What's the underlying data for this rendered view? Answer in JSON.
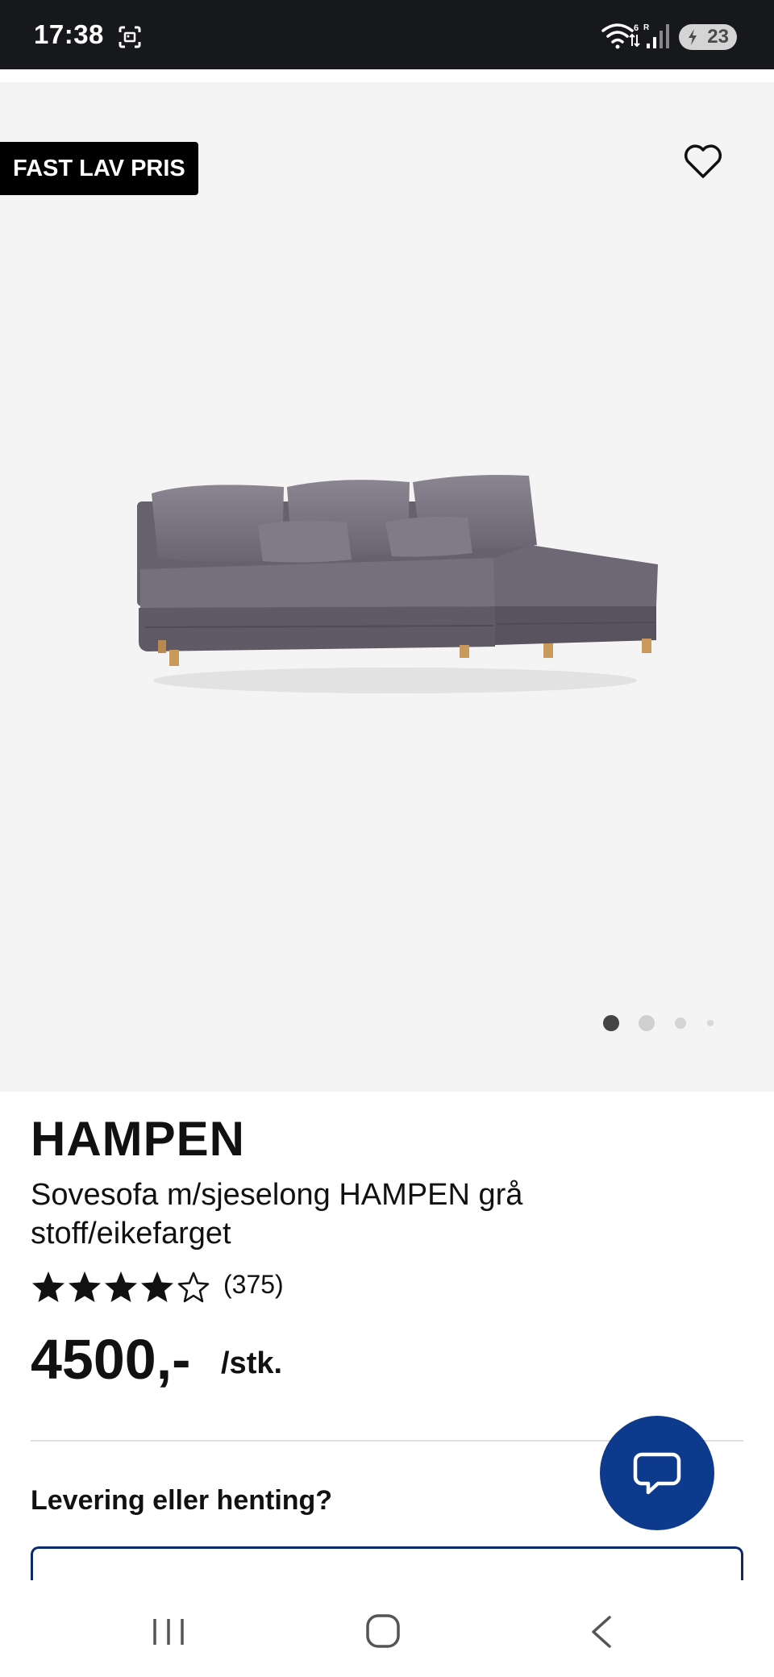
{
  "status_bar": {
    "time": "17:38",
    "wifi_label": "6",
    "signal_label": "R",
    "battery_level": "23",
    "icons": [
      "screenshot-icon",
      "wifi-icon",
      "signal-icon",
      "battery-icon"
    ]
  },
  "hero": {
    "badge": "FAST LAV PRIS",
    "favorite_icon": "heart-outline-icon",
    "image_alt": "sofa-image",
    "carousel": {
      "total": 4,
      "active": 1
    }
  },
  "product": {
    "title": "HAMPEN",
    "subtitle": "Sovesofa m/sjeselong HAMPEN grå stoff/eikefarget",
    "rating": {
      "stars": 4,
      "max": 5,
      "count": "(375)"
    },
    "price": "4500,-",
    "price_unit": "/stk."
  },
  "delivery": {
    "title": "Levering eller henting?"
  },
  "chat": {
    "icon": "chat-bubble-icon"
  },
  "colors": {
    "status_bar_bg": "#17181b",
    "hero_bg": "#f4f4f4",
    "chat_fab": "#0e3a8e",
    "delivery_border": "#0b2a6e"
  },
  "nav_bar": {
    "icons": [
      "recent-apps-icon",
      "home-icon",
      "back-icon"
    ]
  }
}
